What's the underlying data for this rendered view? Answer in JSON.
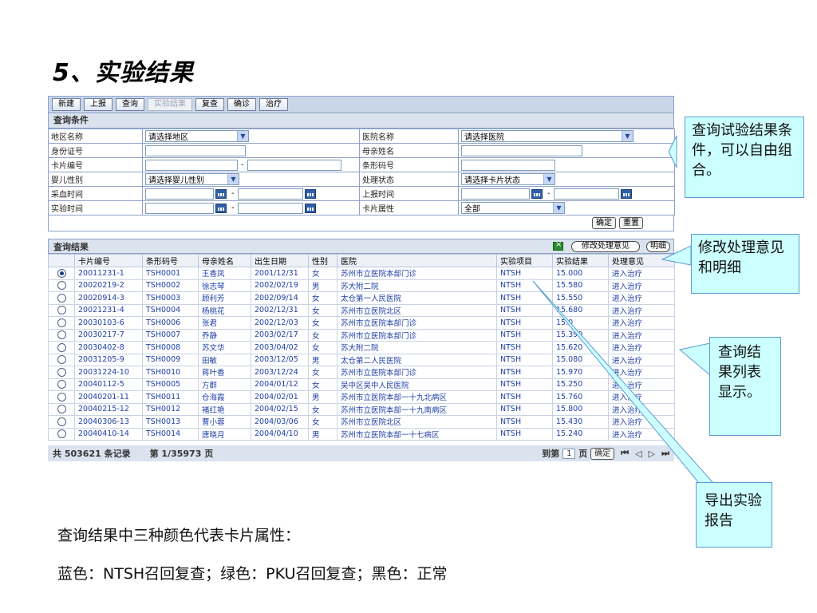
{
  "slide": {
    "title": "5、实验结果",
    "note_line1": "查询结果中三种颜色代表卡片属性：",
    "note_line2": "蓝色：NTSH召回复查；绿色：PKU召回复查；黑色：正常"
  },
  "toolbar": {
    "buttons": [
      "新建",
      "上报",
      "查询",
      "实验结果",
      "复查",
      "确诊",
      "治疗"
    ]
  },
  "conditions": {
    "header": "查询条件",
    "region_label": "地区名称",
    "region_select": "请选择地区",
    "hospital_label": "医院名称",
    "hospital_select": "请选择医院",
    "id_label": "身份证号",
    "mother_label": "母亲姓名",
    "card_label": "卡片编号",
    "barcode_label": "条形码号",
    "gender_label": "婴儿性别",
    "gender_select": "请选择婴儿性别",
    "status_label": "处理状态",
    "status_select": "请选择卡片状态",
    "blood_label": "采血时间",
    "report_label": "上报时间",
    "test_label": "实验时间",
    "attr_label": "卡片属性",
    "attr_select": "全部",
    "range_sep": "-",
    "confirm_label": "确定",
    "reset_label": "重置"
  },
  "results": {
    "header": "查询结果",
    "modify_label": "修改处理意见",
    "detail_label": "明细",
    "columns": [
      "卡片编号",
      "条形码号",
      "母亲姓名",
      "出生日期",
      "性别",
      "医院",
      "实验项目",
      "实验结果",
      "处理意见"
    ],
    "rows": [
      {
        "card": "20011231-1",
        "barcode": "TSH0001",
        "mother": "王香凤",
        "birth": "2001/12/31",
        "sex": "女",
        "hospital": "苏州市立医院本部门诊",
        "item": "NTSH",
        "value": "15.000",
        "action": "进入治疗"
      },
      {
        "card": "20020219-2",
        "barcode": "TSH0002",
        "mother": "徐志琴",
        "birth": "2002/02/19",
        "sex": "男",
        "hospital": "苏大附二院",
        "item": "NTSH",
        "value": "15.580",
        "action": "进入治疗"
      },
      {
        "card": "20020914-3",
        "barcode": "TSH0003",
        "mother": "顾利芳",
        "birth": "2002/09/14",
        "sex": "女",
        "hospital": "太仓第一人民医院",
        "item": "NTSH",
        "value": "15.550",
        "action": "进入治疗"
      },
      {
        "card": "20021231-4",
        "barcode": "TSH0004",
        "mother": "杨桃花",
        "birth": "2002/12/31",
        "sex": "女",
        "hospital": "苏州市立医院北区",
        "item": "NTSH",
        "value": "15.680",
        "action": "进入治疗"
      },
      {
        "card": "20030103-6",
        "barcode": "TSH0006",
        "mother": "张君",
        "birth": "2002/12/03",
        "sex": "女",
        "hospital": "苏州市立医院本部门诊",
        "item": "NTSH",
        "value": "15.0",
        "action": "进入治疗"
      },
      {
        "card": "20030217-7",
        "barcode": "TSH0007",
        "mother": "乔静",
        "birth": "2003/02/17",
        "sex": "女",
        "hospital": "苏州市立医院本部门诊",
        "item": "NTSH",
        "value": "15.390",
        "action": "进入治疗"
      },
      {
        "card": "20030402-8",
        "barcode": "TSH0008",
        "mother": "苏文华",
        "birth": "2003/04/02",
        "sex": "女",
        "hospital": "苏大附二院",
        "item": "NTSH",
        "value": "15.620",
        "action": "进入治疗"
      },
      {
        "card": "20031205-9",
        "barcode": "TSH0009",
        "mother": "田敏",
        "birth": "2003/12/05",
        "sex": "男",
        "hospital": "太仓第二人民医院",
        "item": "NTSH",
        "value": "15.080",
        "action": "进入治疗"
      },
      {
        "card": "20031224-10",
        "barcode": "TSH0010",
        "mother": "蒋叶香",
        "birth": "2003/12/24",
        "sex": "女",
        "hospital": "苏州市立医院本部门诊",
        "item": "NTSH",
        "value": "15.970",
        "action": "进入治疗"
      },
      {
        "card": "20040112-5",
        "barcode": "TSH0005",
        "mother": "方群",
        "birth": "2004/01/12",
        "sex": "女",
        "hospital": "吴中区吴中人民医院",
        "item": "NTSH",
        "value": "15.250",
        "action": "进入治疗"
      },
      {
        "card": "20040201-11",
        "barcode": "TSH0011",
        "mother": "仓海霞",
        "birth": "2004/02/01",
        "sex": "男",
        "hospital": "苏州市立医院本部一十九北病区",
        "item": "NTSH",
        "value": "15.760",
        "action": "进入治疗"
      },
      {
        "card": "20040215-12",
        "barcode": "TSH0012",
        "mother": "褚红艳",
        "birth": "2004/02/15",
        "sex": "女",
        "hospital": "苏州市立医院本部一十九南病区",
        "item": "NTSH",
        "value": "15.800",
        "action": "进入治疗"
      },
      {
        "card": "20040306-13",
        "barcode": "TSH0013",
        "mother": "曹小蓉",
        "birth": "2004/03/06",
        "sex": "女",
        "hospital": "苏州市立医院北区",
        "item": "NTSH",
        "value": "15.430",
        "action": "进入治疗"
      },
      {
        "card": "20040410-14",
        "barcode": "TSH0014",
        "mother": "唐晓月",
        "birth": "2004/04/10",
        "sex": "男",
        "hospital": "苏州市立医院本部一十七病区",
        "item": "NTSH",
        "value": "15.240",
        "action": "进入治疗"
      }
    ],
    "selected_row": 0
  },
  "pager": {
    "total": "共 503621 条记录",
    "page_info": "第 1/35973 页",
    "goto_prefix": "到第",
    "page_value": "1",
    "page_suffix": "页",
    "confirm_label": "确定",
    "nav_icons": [
      "first-page-icon",
      "prev-page-icon",
      "next-page-icon",
      "last-page-icon"
    ]
  },
  "callouts": {
    "query": "查询试验结果条件，可以自由组合。",
    "modify": "修改处理意见和明细",
    "list": "查询结果列表显示。",
    "export": "导出实验报告"
  },
  "colors": {
    "callout_bg": "#ccffff",
    "callout_border": "#5b9bd5",
    "table_text": "#1f3fa8",
    "header_bg": "#dbe3ef"
  }
}
